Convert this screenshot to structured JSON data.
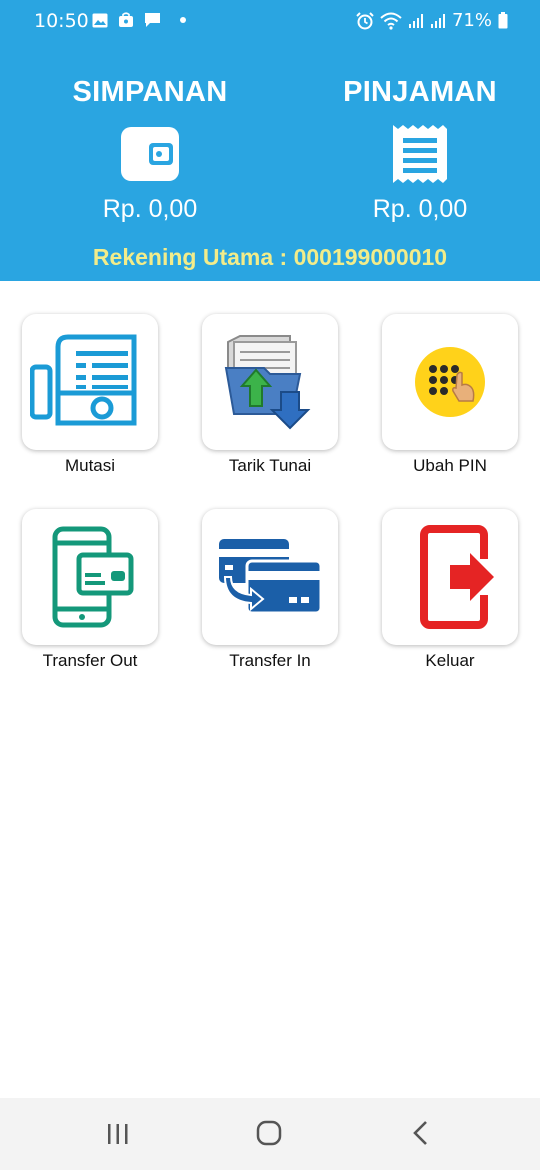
{
  "status_bar": {
    "time": "10:50",
    "battery": "71%",
    "icons": [
      "image-icon",
      "bag-icon",
      "message-icon",
      "dot-icon",
      "alarm-icon",
      "wifi-icon",
      "signal-icon",
      "signal-icon",
      "battery-icon"
    ]
  },
  "header": {
    "simpanan": {
      "title": "SIMPANAN",
      "amount": "Rp. 0,00",
      "icon": "wallet-icon"
    },
    "pinjaman": {
      "title": "PINJAMAN",
      "amount": "Rp. 0,00",
      "icon": "receipt-icon"
    },
    "rekening": "Rekening Utama : 000199000010",
    "colors": {
      "background": "#2aa5e1",
      "rekening_text": "#f2ec8a"
    }
  },
  "menu": [
    {
      "label": "Mutasi",
      "icon": "statement-fax-icon"
    },
    {
      "label": "Tarik Tunai",
      "icon": "folder-transfer-icon"
    },
    {
      "label": "Ubah PIN",
      "icon": "keypad-icon"
    },
    {
      "label": "Transfer Out",
      "icon": "phone-card-icon"
    },
    {
      "label": "Transfer In",
      "icon": "cards-transfer-icon"
    },
    {
      "label": "Keluar",
      "icon": "exit-icon"
    }
  ],
  "nav": {
    "icons": [
      "recent-apps-icon",
      "home-icon",
      "back-icon"
    ]
  }
}
